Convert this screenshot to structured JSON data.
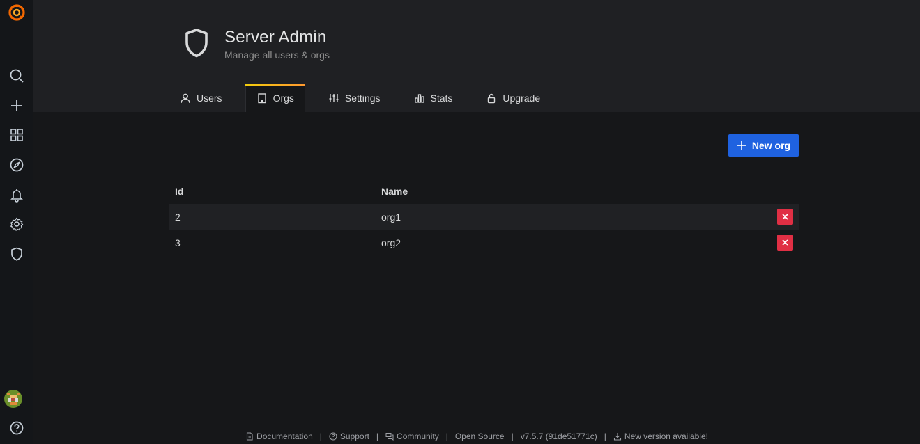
{
  "sidebar": {
    "items": [
      {
        "icon": "grafana-logo-icon"
      },
      {
        "icon": "search-icon"
      },
      {
        "icon": "plus-icon"
      },
      {
        "icon": "dashboards-icon"
      },
      {
        "icon": "explore-compass-icon"
      },
      {
        "icon": "alerting-bell-icon"
      },
      {
        "icon": "configuration-gear-icon"
      },
      {
        "icon": "server-admin-shield-icon"
      },
      {
        "icon": "user-avatar"
      },
      {
        "icon": "help-icon"
      }
    ]
  },
  "header": {
    "title": "Server Admin",
    "subtitle": "Manage all users & orgs",
    "icon": "shield-icon"
  },
  "tabs": [
    {
      "label": "Users",
      "icon": "user-icon",
      "active": false
    },
    {
      "label": "Orgs",
      "icon": "building-icon",
      "active": true
    },
    {
      "label": "Settings",
      "icon": "sliders-icon",
      "active": false
    },
    {
      "label": "Stats",
      "icon": "bar-chart-icon",
      "active": false
    },
    {
      "label": "Upgrade",
      "icon": "unlock-icon",
      "active": false
    }
  ],
  "actions": {
    "new_org_label": "New org"
  },
  "table": {
    "columns": [
      "Id",
      "Name"
    ],
    "rows": [
      {
        "id": "2",
        "name": "org1"
      },
      {
        "id": "3",
        "name": "org2"
      }
    ]
  },
  "footer": {
    "documentation": "Documentation",
    "support": "Support",
    "community": "Community",
    "open_source": "Open Source",
    "version": "v7.5.7 (91de51771c)",
    "new_version": "New version available!",
    "separator": "|"
  },
  "colors": {
    "background": "#161719",
    "header": "#1f2023",
    "primary_button": "#1f62e0",
    "danger": "#e02f44",
    "tab_accent_start": "#f2cc0c",
    "tab_accent_end": "#ff9830"
  }
}
